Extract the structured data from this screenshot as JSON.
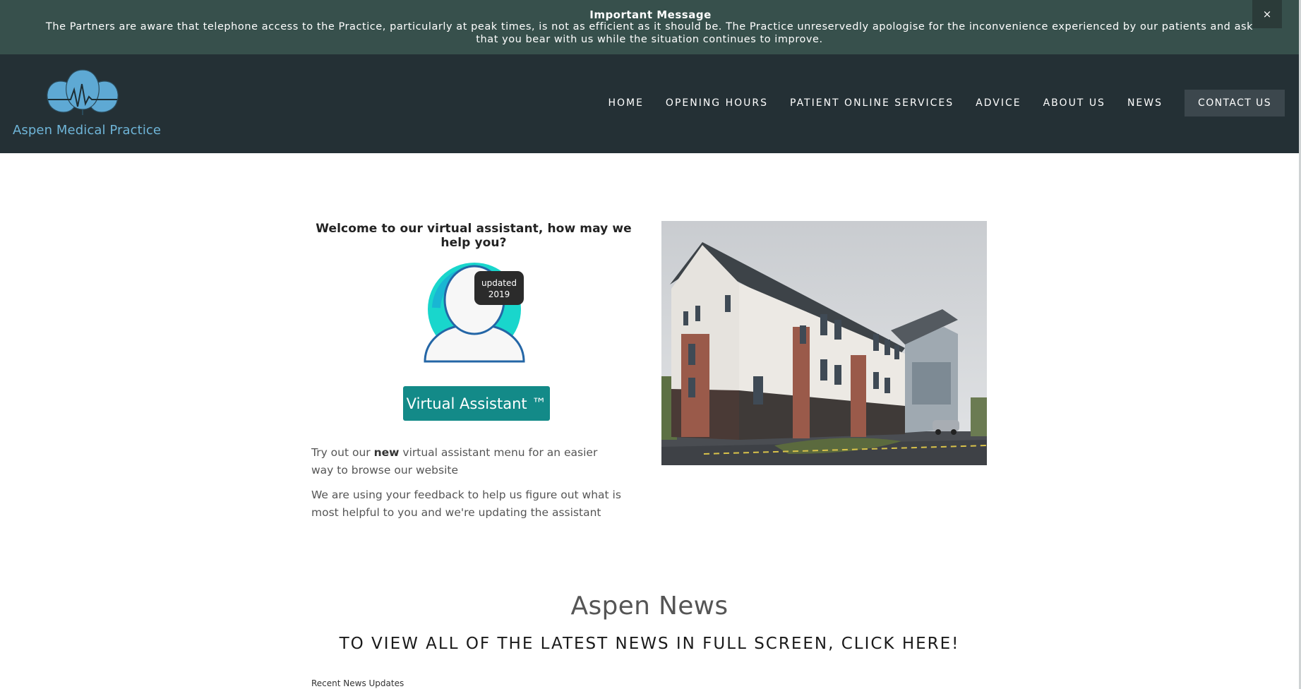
{
  "announcement": {
    "title": "Important Message",
    "body": "The Partners are aware that telephone access to the Practice, particularly at peak times, is not as efficient as it should be. The Practice unreservedly apologise for the inconvenience experienced by our patients and ask that you bear with us while the situation continues to improve.",
    "close_label": "×"
  },
  "brand": {
    "name": "Aspen Medical Practice",
    "logo_color": "#5ea9d4"
  },
  "nav": {
    "items": [
      "HOME",
      "OPENING HOURS",
      "PATIENT ONLINE SERVICES",
      "ADVICE",
      "ABOUT US",
      "NEWS"
    ],
    "cta": "CONTACT US"
  },
  "assistant": {
    "heading": "Welcome to our virtual assistant, how may we help you?",
    "badge_line1": "updated",
    "badge_line2": "2019",
    "button_label": "Virtual Assistant ™",
    "para1_before": "Try out our ",
    "para1_bold": "new",
    "para1_after": " virtual assistant menu for an easier way to browse our website",
    "para2": "We are using your feedback to help us figure out what is most helpful to you and we're updating the assistant"
  },
  "news": {
    "title": "Aspen News",
    "link": "TO VIEW ALL OF THE LATEST NEWS IN FULL SCREEN, CLICK HERE!",
    "recent_label": "Recent News Updates"
  },
  "colors": {
    "announce_bg": "#37504c",
    "header_bg": "#243035",
    "accent": "#138a88"
  }
}
